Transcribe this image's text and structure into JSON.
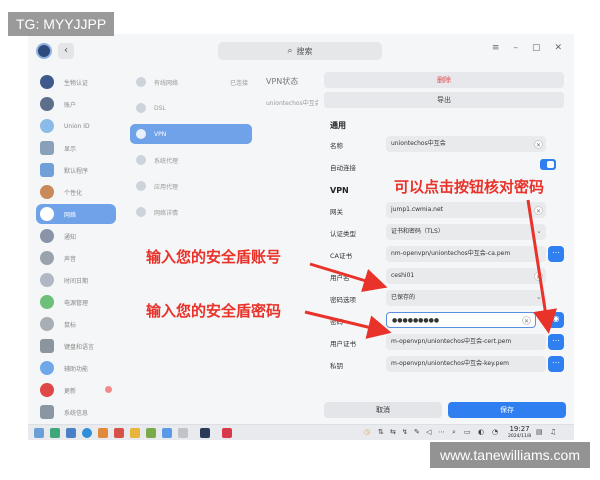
{
  "watermarks": {
    "top_left": "TG: MYYJJPP",
    "bottom_right": "www.tanewilliams.com"
  },
  "topbar": {
    "back_icon": "chevron-left-icon",
    "search_placeholder": "搜索"
  },
  "sidebar": {
    "items": [
      {
        "label": "生物认证",
        "color": "#3d5a8a"
      },
      {
        "label": "账户",
        "color": "#5b6f8a"
      },
      {
        "label": "Union ID",
        "color": "#8bbbe8"
      },
      {
        "label": "显示",
        "color": "#8a9fb8"
      },
      {
        "label": "默认程序",
        "color": "#6fa0d8"
      },
      {
        "label": "个性化",
        "color": "#c88a5a"
      },
      {
        "label": "网络",
        "color": "#ffffff"
      },
      {
        "label": "通知",
        "color": "#8a94a8"
      },
      {
        "label": "声音",
        "color": "#9aa2ae"
      },
      {
        "label": "时间日期",
        "color": "#b0b8c4"
      },
      {
        "label": "电源管理",
        "color": "#6cc07a"
      },
      {
        "label": "鼠标",
        "color": "#a8aeb6"
      },
      {
        "label": "键盘和语言",
        "color": "#8c949e"
      },
      {
        "label": "辅助功能",
        "color": "#6fa8e8"
      },
      {
        "label": "更新",
        "color": "#e04848"
      },
      {
        "label": "系统信息",
        "color": "#8a96a4"
      }
    ]
  },
  "mid": {
    "items": [
      {
        "label": "有线网络",
        "status": "已连接"
      },
      {
        "label": "DSL",
        "status": ""
      },
      {
        "label": "VPN",
        "status": ""
      },
      {
        "label": "系统代理",
        "status": ""
      },
      {
        "label": "应用代理",
        "status": ""
      },
      {
        "label": "网络详情",
        "status": ""
      }
    ]
  },
  "vpn_status": {
    "title": "VPN状态",
    "item": "uniontechos中互会"
  },
  "form": {
    "delete_label": "删除",
    "export_label": "导出",
    "general_title": "通用",
    "name_label": "名称",
    "name_value": "uniontechos中互会",
    "autoconnect_label": "自动连接",
    "vpn_title": "VPN",
    "gateway_label": "网关",
    "gateway_value": "jump1.cwmia.net",
    "auth_label": "认证类型",
    "auth_value": "证书和密码（TLS）",
    "ca_label": "CA证书",
    "ca_value": "nm-openvpn/uniontechos中互会-ca.pem",
    "user_label": "用户名",
    "user_value": "ceshi01",
    "pwopt_label": "密码选项",
    "pwopt_value": "已保存的",
    "pw_label": "密码",
    "pw_value": "●●●●●●●●●",
    "usercert_label": "用户证书",
    "usercert_value": "m-openvpn/uniontechos中互会-cert.pem",
    "key_label": "私钥",
    "key_value": "m-openvpn/uniontechos中互会-key.pem",
    "cancel_label": "取消",
    "save_label": "保存",
    "accent": "#2f7ff0"
  },
  "taskbar": {
    "time": "19:27",
    "date": "2024/11/8"
  },
  "annotations": {
    "a1": "可以点击按钮核对密码",
    "a2": "输入您的安全盾账号",
    "a3": "输入您的安全盾密码",
    "color": "#e8322a"
  }
}
